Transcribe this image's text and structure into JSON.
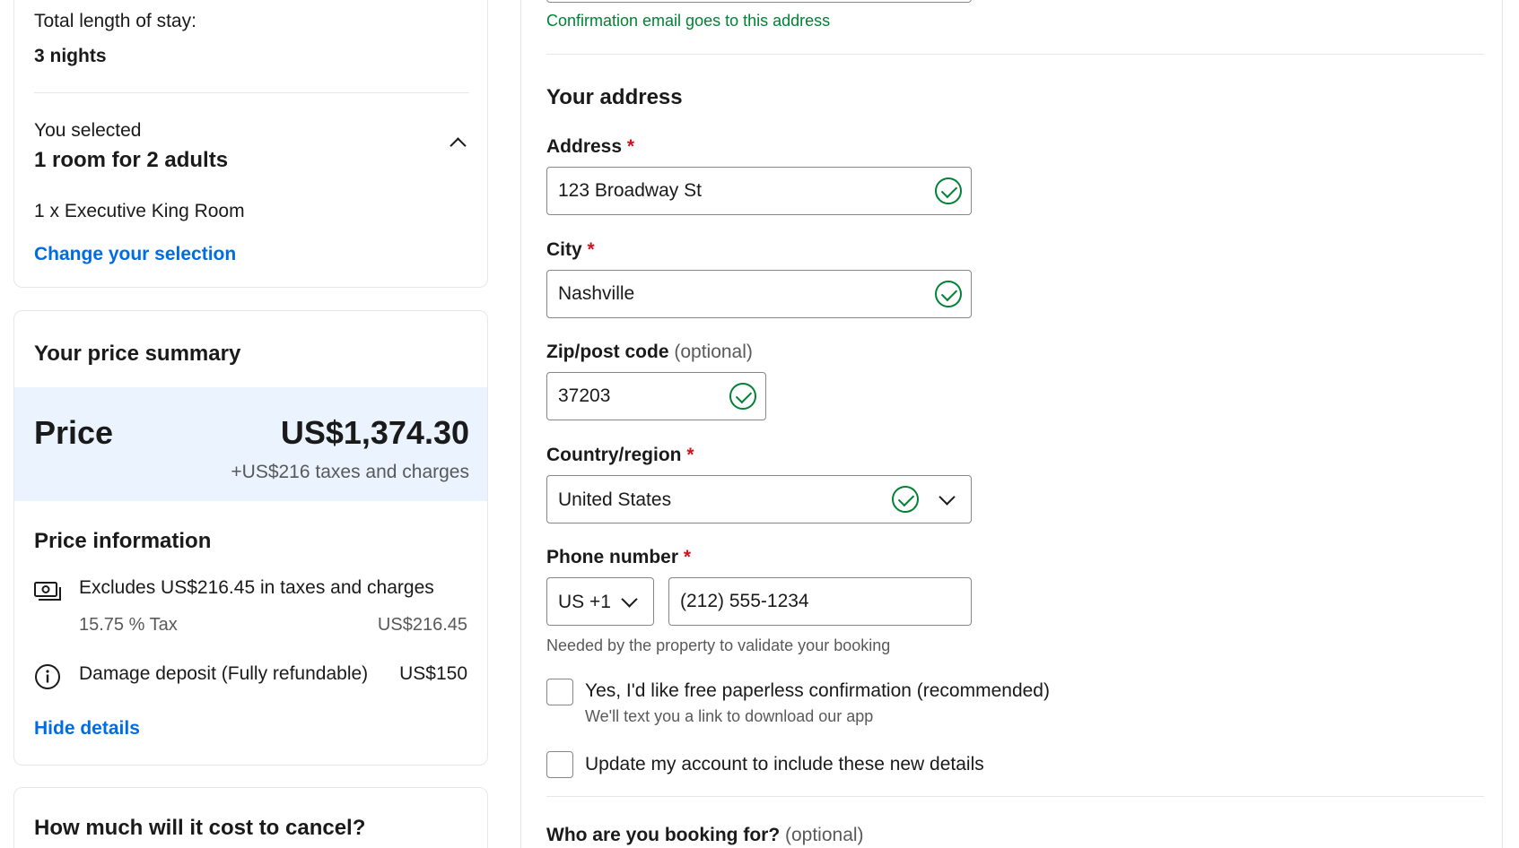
{
  "stay": {
    "length_label": "Total length of stay:",
    "length_value": "3 nights",
    "selected_label": "You selected",
    "selected_value": "1 room for 2 adults",
    "room_line": "1 x Executive King Room",
    "change_link": "Change your selection"
  },
  "price_summary": {
    "heading": "Your price summary",
    "price_label": "Price",
    "price_value": "US$1,374.30",
    "taxes_note": "+US$216 taxes and charges",
    "info_heading": "Price information",
    "excludes_text": "Excludes US$216.45 in taxes and charges",
    "tax_label": "15.75 % Tax",
    "tax_value": "US$216.45",
    "deposit_label": "Damage deposit (Fully refundable)",
    "deposit_value": "US$150",
    "hide_link": "Hide details"
  },
  "cancel": {
    "heading": "How much will it cost to cancel?"
  },
  "form": {
    "email_hint": "Confirmation email goes to this address",
    "address_heading": "Your address",
    "address_label": "Address",
    "address_value": "123 Broadway St",
    "city_label": "City",
    "city_value": "Nashville",
    "zip_label": "Zip/post code",
    "zip_optional": "(optional)",
    "zip_value": "37203",
    "country_label": "Country/region",
    "country_value": "United States",
    "phone_label": "Phone number",
    "phone_code": "US +1",
    "phone_value": "(212) 555-1234",
    "phone_hint": "Needed by the property to validate your booking",
    "required_mark": "*",
    "paperless_label": "Yes, I'd like free paperless confirmation (recommended)",
    "paperless_sub": "We'll text you a link to download our app",
    "update_label": "Update my account to include these new details",
    "booking_for_label": "Who are you booking for?",
    "booking_for_optional": "(optional)"
  },
  "colors": {
    "link": "#006ce4",
    "success": "#008234",
    "required": "#d4111e",
    "price_band": "#ebf3ff"
  }
}
